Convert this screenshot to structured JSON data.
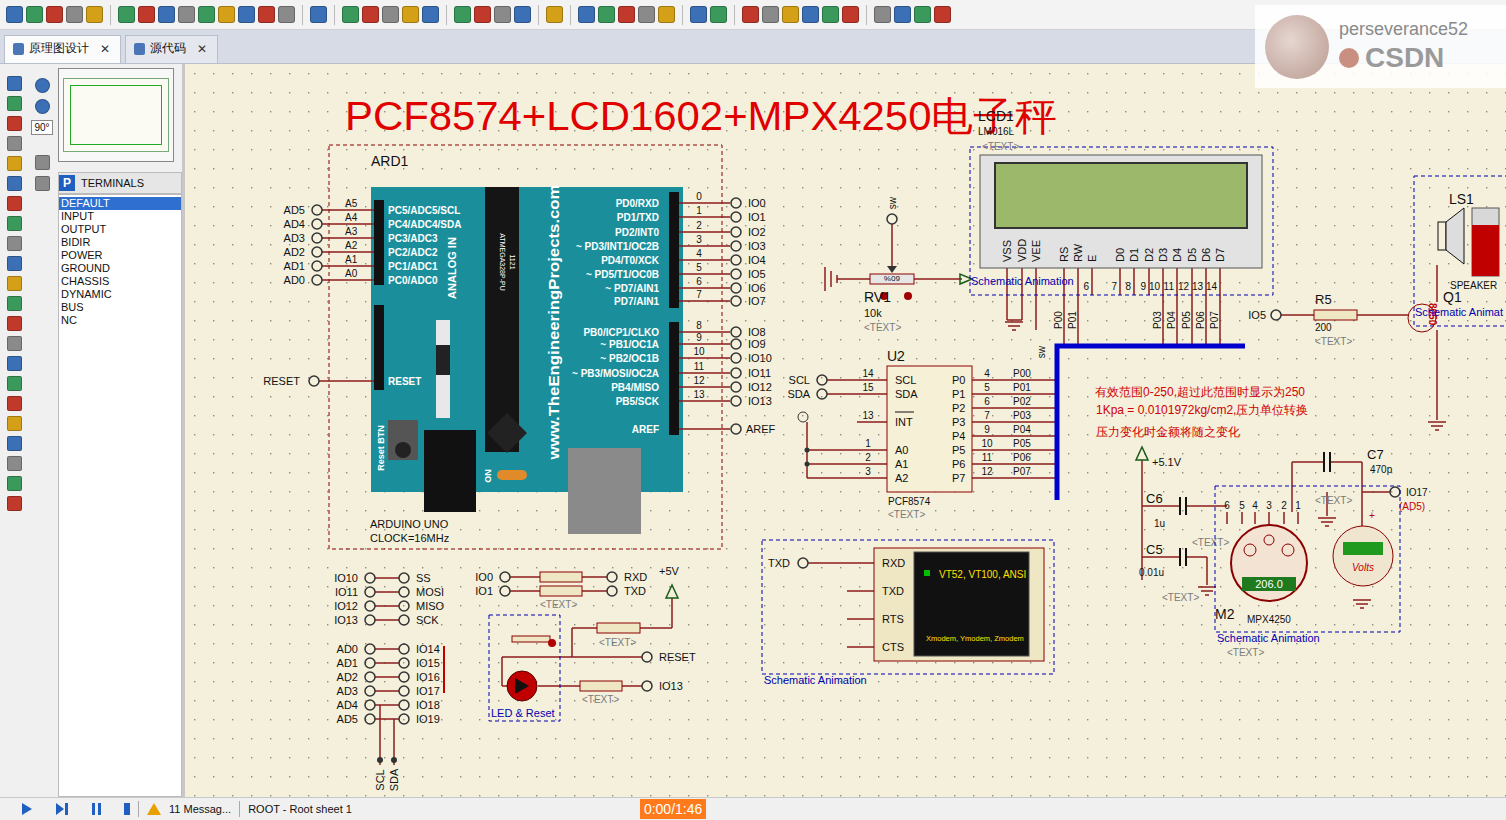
{
  "toolbar": {
    "watermark_user": "perseverance52",
    "watermark_brand": "CSDN"
  },
  "tabs": [
    {
      "label": "原理图设计",
      "selected": true,
      "close": "✕"
    },
    {
      "label": "源代码",
      "selected": false,
      "close": "✕"
    }
  ],
  "sidebar": {
    "rotation": "90°",
    "picker": "P",
    "header": "TERMINALS",
    "items": [
      {
        "label": "DEFAULT",
        "selected": true
      },
      {
        "label": "INPUT",
        "selected": false
      },
      {
        "label": "OUTPUT",
        "selected": false
      },
      {
        "label": "BIDIR",
        "selected": false
      },
      {
        "label": "POWER",
        "selected": false
      },
      {
        "label": "GROUND",
        "selected": false
      },
      {
        "label": "CHASSIS",
        "selected": false
      },
      {
        "label": "DYNAMIC",
        "selected": false
      },
      {
        "label": "BUS",
        "selected": false
      },
      {
        "label": "NC",
        "selected": false
      }
    ]
  },
  "schematic": {
    "title": "PCF8574+LCD1602+MPX4250电子秤",
    "arduino": {
      "ref": "ARD1",
      "model": "ARDUINO UNO",
      "clock": "CLOCK=16MHz",
      "url": "www.TheEngineeringProjects.com",
      "chip": "ATMEGA328P-PU",
      "chip_code": "1121",
      "analog_in": "ANALOG IN",
      "reset_button": "Reset BTN",
      "power": "ON",
      "analog_pins": [
        {
          "net": "AD5",
          "pin": "A5",
          "label": "PC5/ADC5/SCL"
        },
        {
          "net": "AD4",
          "pin": "A4",
          "label": "PC4/ADC4/SDA"
        },
        {
          "net": "AD3",
          "pin": "A3",
          "label": "PC3/ADC3"
        },
        {
          "net": "AD2",
          "pin": "A2",
          "label": "PC2/ADC2"
        },
        {
          "net": "AD1",
          "pin": "A1",
          "label": "PC1/ADC1"
        },
        {
          "net": "AD0",
          "pin": "A0",
          "label": "PC0/ADC0"
        }
      ],
      "reset": {
        "net": "RESET",
        "label": "RESET"
      },
      "digital_pins": [
        {
          "net": "IO0",
          "pin": "0",
          "label": "PD0/RXD"
        },
        {
          "net": "IO1",
          "pin": "1",
          "label": "PD1/TXD"
        },
        {
          "net": "IO2",
          "pin": "2",
          "label": "PD2/INT0"
        },
        {
          "net": "IO3",
          "pin": "3",
          "label": "~ PD3/INT1/OC2B"
        },
        {
          "net": "IO4",
          "pin": "4",
          "label": "PD4/T0/XCK"
        },
        {
          "net": "IO5",
          "pin": "5",
          "label": "~ PD5/T1/OC0B"
        },
        {
          "net": "IO6",
          "pin": "6",
          "label": "~ PD7/AIN1"
        },
        {
          "net": "IO7",
          "pin": "7",
          "label": "PD7/AIN1"
        },
        {
          "net": "IO8",
          "pin": "8",
          "label": "PB0/ICP1/CLKO"
        },
        {
          "net": "IO9",
          "pin": "9",
          "label": "~ PB1/OC1A"
        },
        {
          "net": "IO10",
          "pin": "10",
          "label": "~ PB2/OC1B"
        },
        {
          "net": "IO11",
          "pin": "11",
          "label": "~ PB3/MOSI/OC2A"
        },
        {
          "net": "IO12",
          "pin": "12",
          "label": "PB4/MISO"
        },
        {
          "net": "IO13",
          "pin": "13",
          "label": "PB5/SCK"
        }
      ],
      "aref": {
        "net": "AREF",
        "label": "AREF"
      }
    },
    "spi_aliases": [
      {
        "from": "IO10",
        "to": "SS"
      },
      {
        "from": "IO11",
        "to": "MOSI"
      },
      {
        "from": "IO12",
        "to": "MISO"
      },
      {
        "from": "IO13",
        "to": "SCK"
      }
    ],
    "analog_aliases": [
      {
        "from": "AD0",
        "to": "IO14"
      },
      {
        "from": "AD1",
        "to": "IO15"
      },
      {
        "from": "AD2",
        "to": "IO16"
      },
      {
        "from": "AD3",
        "to": "IO17"
      },
      {
        "from": "AD4",
        "to": "IO18"
      },
      {
        "from": "AD5",
        "to": "IO19"
      }
    ],
    "i2c_nets": [
      "SCL",
      "SDA"
    ],
    "serial": [
      {
        "from": "IO0",
        "to": "RXD"
      },
      {
        "from": "IO1",
        "to": "TXD"
      }
    ],
    "serial_text": "<TEXT>",
    "led_reset": {
      "supply": "+5V",
      "reset": "RESET",
      "io": "IO13",
      "caption": "LED & Reset",
      "texts": [
        "<TEXT>",
        "<TEXT>"
      ]
    },
    "pot": {
      "net": "sw",
      "ref": "RV1",
      "value": "10k",
      "text": "<TEXT>",
      "percent": "60%"
    },
    "lcd": {
      "ref": "LCD1",
      "model": "LM016L",
      "text": "<TEXT>",
      "animation": "Schematic Animation",
      "ground_net": "sw",
      "pins": [
        {
          "name": "VSS"
        },
        {
          "name": "VDD"
        },
        {
          "name": "VEE"
        },
        {
          "name": "RS",
          "bus": "P00"
        },
        {
          "name": "RW",
          "bus": "P01"
        },
        {
          "name": "E",
          "num": "6"
        },
        {
          "name": "D0",
          "num": "7"
        },
        {
          "name": "D1",
          "num": "8"
        },
        {
          "name": "D2",
          "num": "9"
        },
        {
          "name": "D3",
          "num": "10",
          "bus": "P03"
        },
        {
          "name": "D4",
          "num": "11",
          "bus": "P04"
        },
        {
          "name": "D5",
          "num": "12",
          "bus": "P05"
        },
        {
          "name": "D6",
          "num": "13",
          "bus": "P06"
        },
        {
          "name": "D7",
          "num": "14",
          "bus": "P07"
        }
      ]
    },
    "pcf8574": {
      "ref": "U2",
      "model": "PCF8574",
      "text": "<TEXT>",
      "left_pins": [
        {
          "name": "SCL",
          "num": "14",
          "net": "SCL"
        },
        {
          "name": "SDA",
          "num": "15",
          "net": "SDA"
        },
        {
          "name": "INT",
          "num": "13"
        },
        {
          "name": "A0",
          "num": "1"
        },
        {
          "name": "A1",
          "num": "2"
        },
        {
          "name": "A2",
          "num": "3"
        }
      ],
      "right_pins": [
        {
          "name": "P0",
          "num": "4",
          "net": "P00"
        },
        {
          "name": "P1",
          "num": "5",
          "net": "P01"
        },
        {
          "name": "P2",
          "num": "6",
          "net": "P02"
        },
        {
          "name": "P3",
          "num": "7",
          "net": "P03"
        },
        {
          "name": "P4",
          "num": "9",
          "net": "P04"
        },
        {
          "name": "P5",
          "num": "10",
          "net": "P05"
        },
        {
          "name": "P6",
          "num": "11",
          "net": "P06"
        },
        {
          "name": "P7",
          "num": "12",
          "net": "P07"
        }
      ]
    },
    "speaker": {
      "ref": "LS1",
      "model": "SPEAKER",
      "transistor": "Q1",
      "transistor_model": "8050",
      "resistor": "R5",
      "resistor_value": "200",
      "text": "<TEXT>",
      "net": "IO5",
      "animation": "Schematic Animat",
      "level": 0.75
    },
    "notes": [
      "有效范围0-250,超过此范围时显示为250",
      "1Kpa = 0.0101972kg/cm2,压力单位转换",
      "压力变化时金额将随之变化"
    ],
    "sensor": {
      "supply": "+5.1V",
      "c6": "C6",
      "c6_value": "1u",
      "c5": "C5",
      "c5_value": "0.01u",
      "c7": "C7",
      "c7_value": "470p",
      "cap_texts": [
        "<TEXT>",
        "<TEXT>",
        "<TEXT>"
      ],
      "out_net": "IO17",
      "out_alias": "(AD5)",
      "ref": "M2",
      "model": "MPX4250",
      "reading": "206.0",
      "pins": [
        "6",
        "5",
        "4",
        "3",
        "2",
        "1"
      ],
      "meter_label": "Volts",
      "meter_plus": "+",
      "animation": "Schematic Animation",
      "text": "<TEXT>"
    },
    "terminal": {
      "net": "TXD",
      "pins": [
        "RXD",
        "TXD",
        "RTS",
        "CTS"
      ],
      "modes": "VT52, VT100, ANSI",
      "protocols": "Xmodem, Ymodem, Zmodem",
      "animation": "Schematic Animation"
    }
  },
  "status_bar": {
    "messages": "11 Messag...",
    "sheet": "ROOT - Root sheet 1",
    "time": "0:00/1:46"
  }
}
